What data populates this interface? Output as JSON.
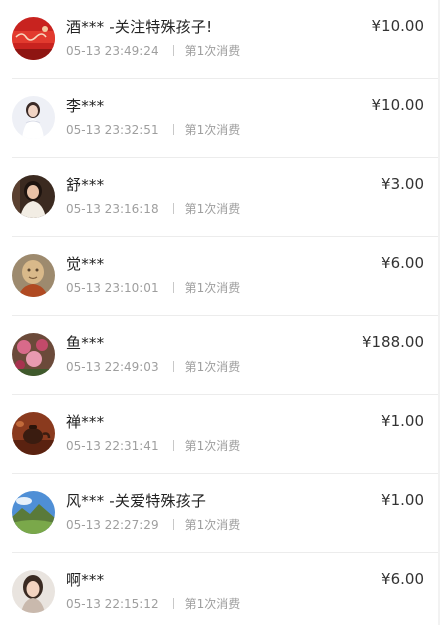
{
  "donations": [
    {
      "name": "酒*** -关注特殊孩子!",
      "time": "05-13 23:49:24",
      "count_label": "第1次消费",
      "amount": "¥10.00",
      "avatar_icon": "red-banner-avatar"
    },
    {
      "name": "李***",
      "time": "05-13 23:32:51",
      "count_label": "第1次消费",
      "amount": "¥10.00",
      "avatar_icon": "woman-white-dress-avatar"
    },
    {
      "name": "舒***",
      "time": "05-13 23:16:18",
      "count_label": "第1次消费",
      "amount": "¥3.00",
      "avatar_icon": "woman-portrait-avatar"
    },
    {
      "name": "觉***",
      "time": "05-13 23:10:01",
      "count_label": "第1次消费",
      "amount": "¥6.00",
      "avatar_icon": "buddha-statue-avatar"
    },
    {
      "name": "鱼***",
      "time": "05-13 22:49:03",
      "count_label": "第1次消费",
      "amount": "¥188.00",
      "avatar_icon": "flowers-avatar"
    },
    {
      "name": "禅***",
      "time": "05-13 22:31:41",
      "count_label": "第1次消费",
      "amount": "¥1.00",
      "avatar_icon": "teapot-avatar"
    },
    {
      "name": "风*** -关爱特殊孩子",
      "time": "05-13 22:27:29",
      "count_label": "第1次消费",
      "amount": "¥1.00",
      "avatar_icon": "landscape-avatar"
    },
    {
      "name": "啊***",
      "time": "05-13 22:15:12",
      "count_label": "第1次消费",
      "amount": "¥6.00",
      "avatar_icon": "girl-portrait-avatar"
    }
  ]
}
